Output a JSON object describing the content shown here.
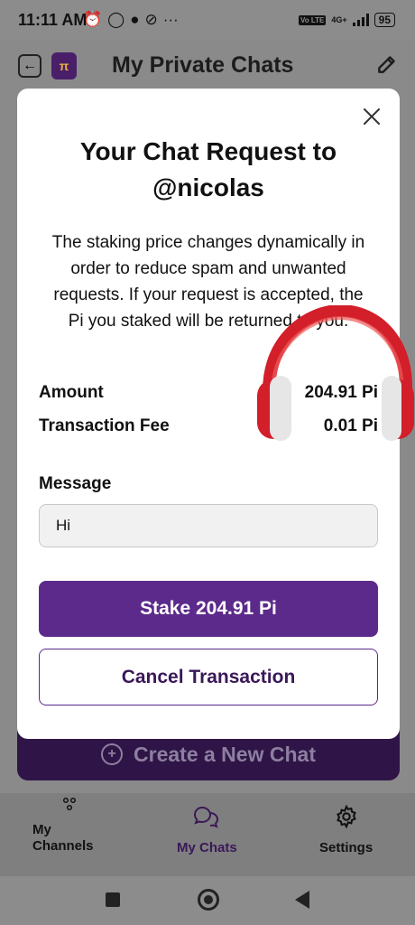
{
  "status_bar": {
    "time": "11:11 AM",
    "network": "4G+",
    "volte": "Vo LTE",
    "battery": "95"
  },
  "header": {
    "title": "My Private Chats"
  },
  "modal": {
    "title": "Your Chat Request to @nicolas",
    "description": "The staking price changes dynamically in order to reduce spam and unwanted requests. If your request is accepted, the Pi you staked will be returned to you.",
    "amount_label": "Amount",
    "amount_value": "204.91 Pi",
    "fee_label": "Transaction Fee",
    "fee_value": "0.01 Pi",
    "message_label": "Message",
    "message_value": "Hi",
    "stake_button": "Stake 204.91 Pi",
    "cancel_button": "Cancel Transaction"
  },
  "background": {
    "create_chat_button": "Create a New Chat"
  },
  "bottom_nav": {
    "items": [
      {
        "label": "My Channels",
        "icon": "channels-icon"
      },
      {
        "label": "My Chats",
        "icon": "chat-bubbles-icon",
        "active": true
      },
      {
        "label": "Settings",
        "icon": "gear-icon"
      }
    ]
  },
  "colors": {
    "primary": "#5b2a8a",
    "dark_primary": "#3a1858",
    "overlay_gray": "#8a8a8a"
  }
}
